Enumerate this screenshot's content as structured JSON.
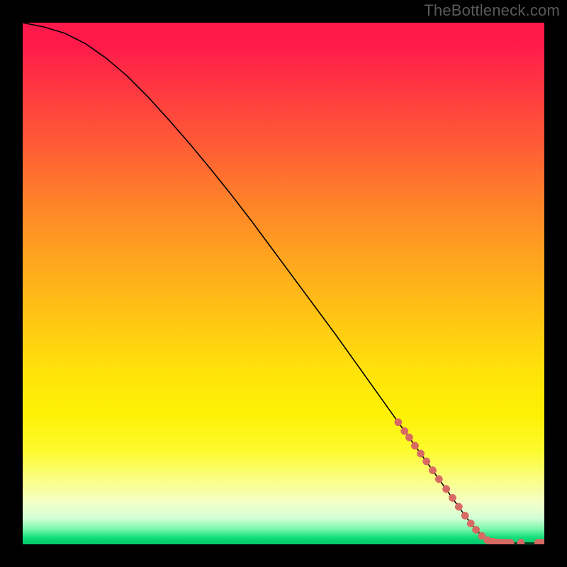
{
  "watermark": "TheBottleneck.com",
  "colors": {
    "dot": "#d86a64",
    "line": "#000000",
    "frame": "#000000"
  },
  "chart_data": {
    "type": "line",
    "title": "",
    "xlabel": "",
    "ylabel": "",
    "xlim": [
      0,
      100
    ],
    "ylim": [
      0,
      100
    ],
    "grid": false,
    "series": [
      {
        "name": "curve",
        "x": [
          0,
          4,
          8,
          12,
          16,
          20,
          24,
          28,
          32,
          36,
          40,
          44,
          48,
          52,
          56,
          60,
          64,
          68,
          72,
          76,
          80,
          84,
          86,
          88,
          90,
          92,
          94,
          96,
          98,
          100
        ],
        "y": [
          100,
          99.2,
          98.0,
          96.0,
          93.2,
          89.8,
          85.8,
          81.4,
          76.8,
          72.0,
          67.0,
          61.8,
          56.4,
          51.0,
          45.6,
          40.2,
          34.6,
          29.0,
          23.4,
          17.8,
          12.2,
          6.6,
          3.9,
          1.6,
          0.6,
          0.3,
          0.25,
          0.25,
          0.25,
          0.25
        ]
      }
    ],
    "points": [
      {
        "x": 72.0,
        "y": 23.4
      },
      {
        "x": 73.2,
        "y": 21.7
      },
      {
        "x": 74.1,
        "y": 20.5
      },
      {
        "x": 75.2,
        "y": 18.9
      },
      {
        "x": 76.3,
        "y": 17.4
      },
      {
        "x": 77.4,
        "y": 15.9
      },
      {
        "x": 78.6,
        "y": 14.2
      },
      {
        "x": 79.8,
        "y": 12.5
      },
      {
        "x": 81.2,
        "y": 10.6
      },
      {
        "x": 82.4,
        "y": 8.9
      },
      {
        "x": 83.6,
        "y": 7.2
      },
      {
        "x": 84.8,
        "y": 5.5
      },
      {
        "x": 85.9,
        "y": 4.0
      },
      {
        "x": 86.9,
        "y": 2.8
      },
      {
        "x": 88.0,
        "y": 1.6
      },
      {
        "x": 89.1,
        "y": 0.8
      },
      {
        "x": 90.0,
        "y": 0.5
      },
      {
        "x": 90.3,
        "y": 0.45
      },
      {
        "x": 91.0,
        "y": 0.35
      },
      {
        "x": 91.3,
        "y": 0.35
      },
      {
        "x": 92.0,
        "y": 0.3
      },
      {
        "x": 92.6,
        "y": 0.3
      },
      {
        "x": 93.5,
        "y": 0.3
      },
      {
        "x": 95.5,
        "y": 0.3
      },
      {
        "x": 98.8,
        "y": 0.3
      },
      {
        "x": 99.5,
        "y": 0.3
      }
    ],
    "gradient_stops": [
      {
        "pos": 0.0,
        "color": "#ff1a4b"
      },
      {
        "pos": 0.23,
        "color": "#ff5a36"
      },
      {
        "pos": 0.45,
        "color": "#ffa41f"
      },
      {
        "pos": 0.67,
        "color": "#ffe30a"
      },
      {
        "pos": 0.82,
        "color": "#fdfb2e"
      },
      {
        "pos": 0.92,
        "color": "#f3ffc8"
      },
      {
        "pos": 0.986,
        "color": "#18e07d"
      },
      {
        "pos": 1.0,
        "color": "#05c86b"
      }
    ]
  }
}
